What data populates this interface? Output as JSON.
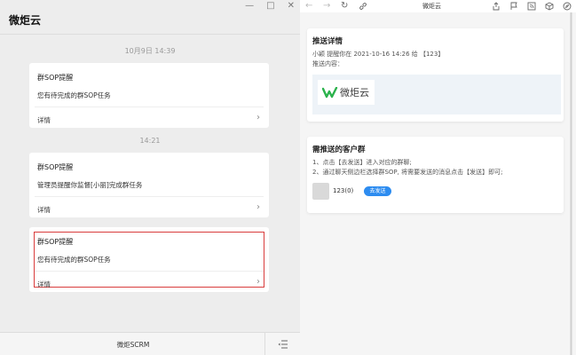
{
  "left": {
    "title": "微炬云",
    "window_controls": [
      "—",
      "□",
      "✕"
    ],
    "messages": [
      {
        "timestamp": "10月9日 14:39",
        "title": "群SOP提醒",
        "desc": "您有待完成的群SOP任务",
        "detail": "详情",
        "selected": false
      },
      {
        "timestamp": "14:21",
        "title": "群SOP提醒",
        "desc": "管理员提醒你监督[小丽]完成群任务",
        "detail": "详情",
        "selected": false
      },
      {
        "timestamp": "",
        "title": "群SOP提醒",
        "desc": "您有待完成的群SOP任务",
        "detail": "详情",
        "selected": true
      }
    ],
    "bottom_label": "微炬SCRM"
  },
  "right": {
    "toolbar": {
      "title": "微炬云",
      "icons": [
        "arrow-left-icon",
        "arrow-right-icon",
        "refresh-icon",
        "link-icon",
        "share-icon",
        "flag-icon",
        "rss-icon",
        "cube-icon",
        "compass-icon"
      ]
    },
    "push_detail": {
      "title": "推送详情",
      "line1": "小颖 提醒你在 2021-10-16 14:26 给 【123】",
      "line2": "推送内容：",
      "logo_text": "微炬云"
    },
    "groups": {
      "title": "需推送的客户群",
      "step1": "1、点击【去发送】进入对应的群聊;",
      "step2": "2、通过聊天侧边栏选择群SOP, 将需要发送的消息点击【发送】即可;",
      "group_name": "123(0)",
      "send_button": "去发送"
    }
  },
  "colors": {
    "accent": "#2d8cf0",
    "selected_border": "#d93c3c",
    "logo_green": "#2bb24c"
  }
}
